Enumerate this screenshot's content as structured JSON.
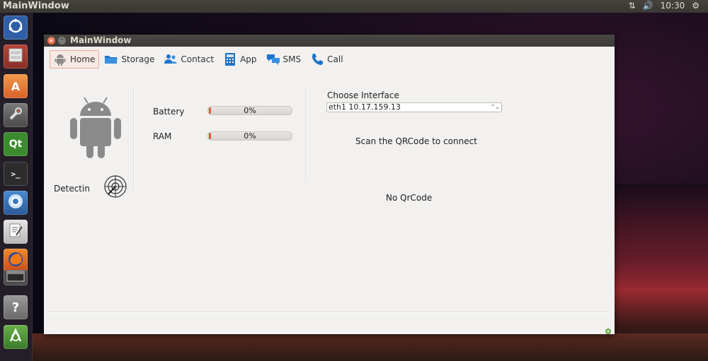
{
  "top_panel": {
    "title": "MainWindow",
    "time": "10:30"
  },
  "launcher": {
    "items": [
      {
        "name": "ubuntu-dash",
        "icon": "ubuntu-logo-icon"
      },
      {
        "name": "files",
        "icon": "file-cabinet-icon"
      },
      {
        "name": "software-center",
        "icon": "software-center-icon",
        "glyph": "A"
      },
      {
        "name": "system-settings",
        "icon": "wrench-icon"
      },
      {
        "name": "qt-creator",
        "icon": "qt-icon",
        "glyph": "Qt"
      },
      {
        "name": "terminal",
        "icon": "terminal-icon",
        "glyph": ">_"
      },
      {
        "name": "chromium",
        "icon": "chromium-icon"
      },
      {
        "name": "text-editor",
        "icon": "text-editor-icon"
      },
      {
        "name": "firefox",
        "icon": "firefox-icon"
      },
      {
        "name": "app-window",
        "icon": "window-icon"
      },
      {
        "name": "help",
        "icon": "help-icon",
        "glyph": "?"
      },
      {
        "name": "android-studio",
        "icon": "android-studio-icon"
      }
    ]
  },
  "window": {
    "title": "MainWindow",
    "tabs": [
      {
        "label": "Home",
        "icon": "android-icon",
        "active": true
      },
      {
        "label": "Storage",
        "icon": "folder-icon",
        "active": false
      },
      {
        "label": "Contact",
        "icon": "contacts-icon",
        "active": false
      },
      {
        "label": "App",
        "icon": "calculator-icon",
        "active": false
      },
      {
        "label": "SMS",
        "icon": "chat-icon",
        "active": false
      },
      {
        "label": "Call",
        "icon": "phone-icon",
        "active": false
      }
    ],
    "device": {
      "detect_label": "Detectin"
    },
    "stats": {
      "battery_label": "Battery",
      "battery_value": "0%",
      "ram_label": "RAM",
      "ram_value": "0%"
    },
    "interface": {
      "label": "Choose Interface",
      "selected": "eth1 10.17.159.13"
    },
    "qr": {
      "instruction": "Scan the QRCode to connect",
      "status": "No QrCode"
    }
  },
  "colors": {
    "accent": "#e05a3a",
    "tab_icon_blue": "#1e73c8",
    "android_gray": "#8a8a8a"
  }
}
